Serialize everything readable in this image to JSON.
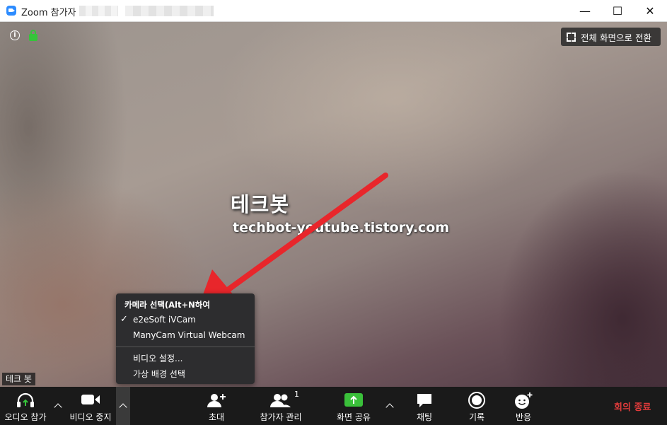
{
  "window": {
    "title": "Zoom 참가자",
    "minimize": "—",
    "maximize": "☐",
    "close": "✕"
  },
  "video": {
    "fullscreen_label": "전체 화면으로 전환",
    "watermark_title": "테크봇",
    "watermark_url": "techbot-youtube.tistory.com",
    "participant_name": "테크 봇"
  },
  "camera_menu": {
    "header": "카메라 선택(Alt+N하여",
    "cameras": [
      "e2eSoft iVCam",
      "ManyCam Virtual Webcam"
    ],
    "selected_check": "✓",
    "video_settings": "비디오 설정...",
    "virtual_bg": "가상 배경 선택"
  },
  "toolbar": {
    "audio": "오디오 참가",
    "video": "비디오 중지",
    "invite": "초대",
    "participants": "참가자 관리",
    "participant_count": "1",
    "share": "화면 공유",
    "chat": "채팅",
    "record": "기록",
    "reactions": "반응",
    "end": "회의 종료"
  },
  "colors": {
    "accent_green": "#35c43a",
    "share_green": "#3ac03a",
    "end_red": "#e23b3b",
    "arrow_red": "#e8262b"
  }
}
